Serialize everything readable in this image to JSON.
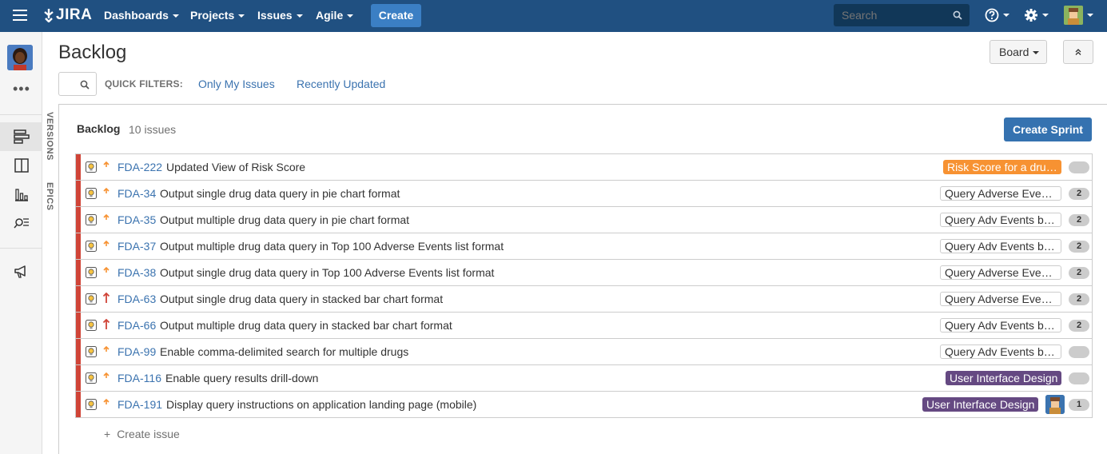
{
  "nav": {
    "logo": "JIRA",
    "items": [
      {
        "label": "Dashboards"
      },
      {
        "label": "Projects"
      },
      {
        "label": "Issues"
      },
      {
        "label": "Agile"
      }
    ],
    "create_label": "Create",
    "search_placeholder": "Search"
  },
  "header": {
    "title": "Backlog",
    "board_label": "Board",
    "quick_filters_label": "QUICK FILTERS:",
    "quick_filters": [
      "Only My Issues",
      "Recently Updated"
    ]
  },
  "side_tabs": {
    "versions": "VERSIONS",
    "epics": "EPICS"
  },
  "sidebar": {
    "more": "•••"
  },
  "backlog": {
    "title": "Backlog",
    "count": "10 issues",
    "create_sprint_label": "Create Sprint",
    "create_issue_label": "Create issue",
    "issues": [
      {
        "key": "FDA-222",
        "summary": "Updated View of Risk Score",
        "priority": "major",
        "epic": "Risk Score for a dru…",
        "epic_style": "orange",
        "estimate": ""
      },
      {
        "key": "FDA-34",
        "summary": "Output single drug data query in pie chart format",
        "priority": "major",
        "epic": "Query Adverse Eve…",
        "epic_style": "grey",
        "estimate": "2"
      },
      {
        "key": "FDA-35",
        "summary": "Output multiple drug data query in pie chart format",
        "priority": "major",
        "epic": "Query Adv Events b…",
        "epic_style": "grey",
        "estimate": "2"
      },
      {
        "key": "FDA-37",
        "summary": "Output multiple drug data query in Top 100 Adverse Events list format",
        "priority": "major",
        "epic": "Query Adv Events b…",
        "epic_style": "grey",
        "estimate": "2"
      },
      {
        "key": "FDA-38",
        "summary": "Output single drug data query in Top 100 Adverse Events list format",
        "priority": "major",
        "epic": "Query Adverse Eve…",
        "epic_style": "grey",
        "estimate": "2"
      },
      {
        "key": "FDA-63",
        "summary": "Output single drug data query in stacked bar chart format",
        "priority": "critical",
        "epic": "Query Adverse Eve…",
        "epic_style": "grey",
        "estimate": "2"
      },
      {
        "key": "FDA-66",
        "summary": "Output multiple drug data query in stacked bar chart format",
        "priority": "critical",
        "epic": "Query Adv Events b…",
        "epic_style": "grey",
        "estimate": "2"
      },
      {
        "key": "FDA-99",
        "summary": "Enable comma-delimited search for multiple drugs",
        "priority": "major",
        "epic": "Query Adv Events b…",
        "epic_style": "grey",
        "estimate": ""
      },
      {
        "key": "FDA-116",
        "summary": "Enable query results drill-down",
        "priority": "major",
        "epic": "User Interface Design",
        "epic_style": "purple",
        "estimate": ""
      },
      {
        "key": "FDA-191",
        "summary": "Display query instructions on application landing page (mobile)",
        "priority": "major",
        "epic": "User Interface Design",
        "epic_style": "purple",
        "estimate": "1",
        "assignee": true
      }
    ]
  },
  "colors": {
    "header_bg": "#205081",
    "primary_button": "#3572b0",
    "link": "#3b73af",
    "rank_bar": "#d04437",
    "epic_orange": "#f79232",
    "epic_purple": "#654982",
    "priority_major": "#f79232",
    "priority_critical": "#d04437"
  }
}
